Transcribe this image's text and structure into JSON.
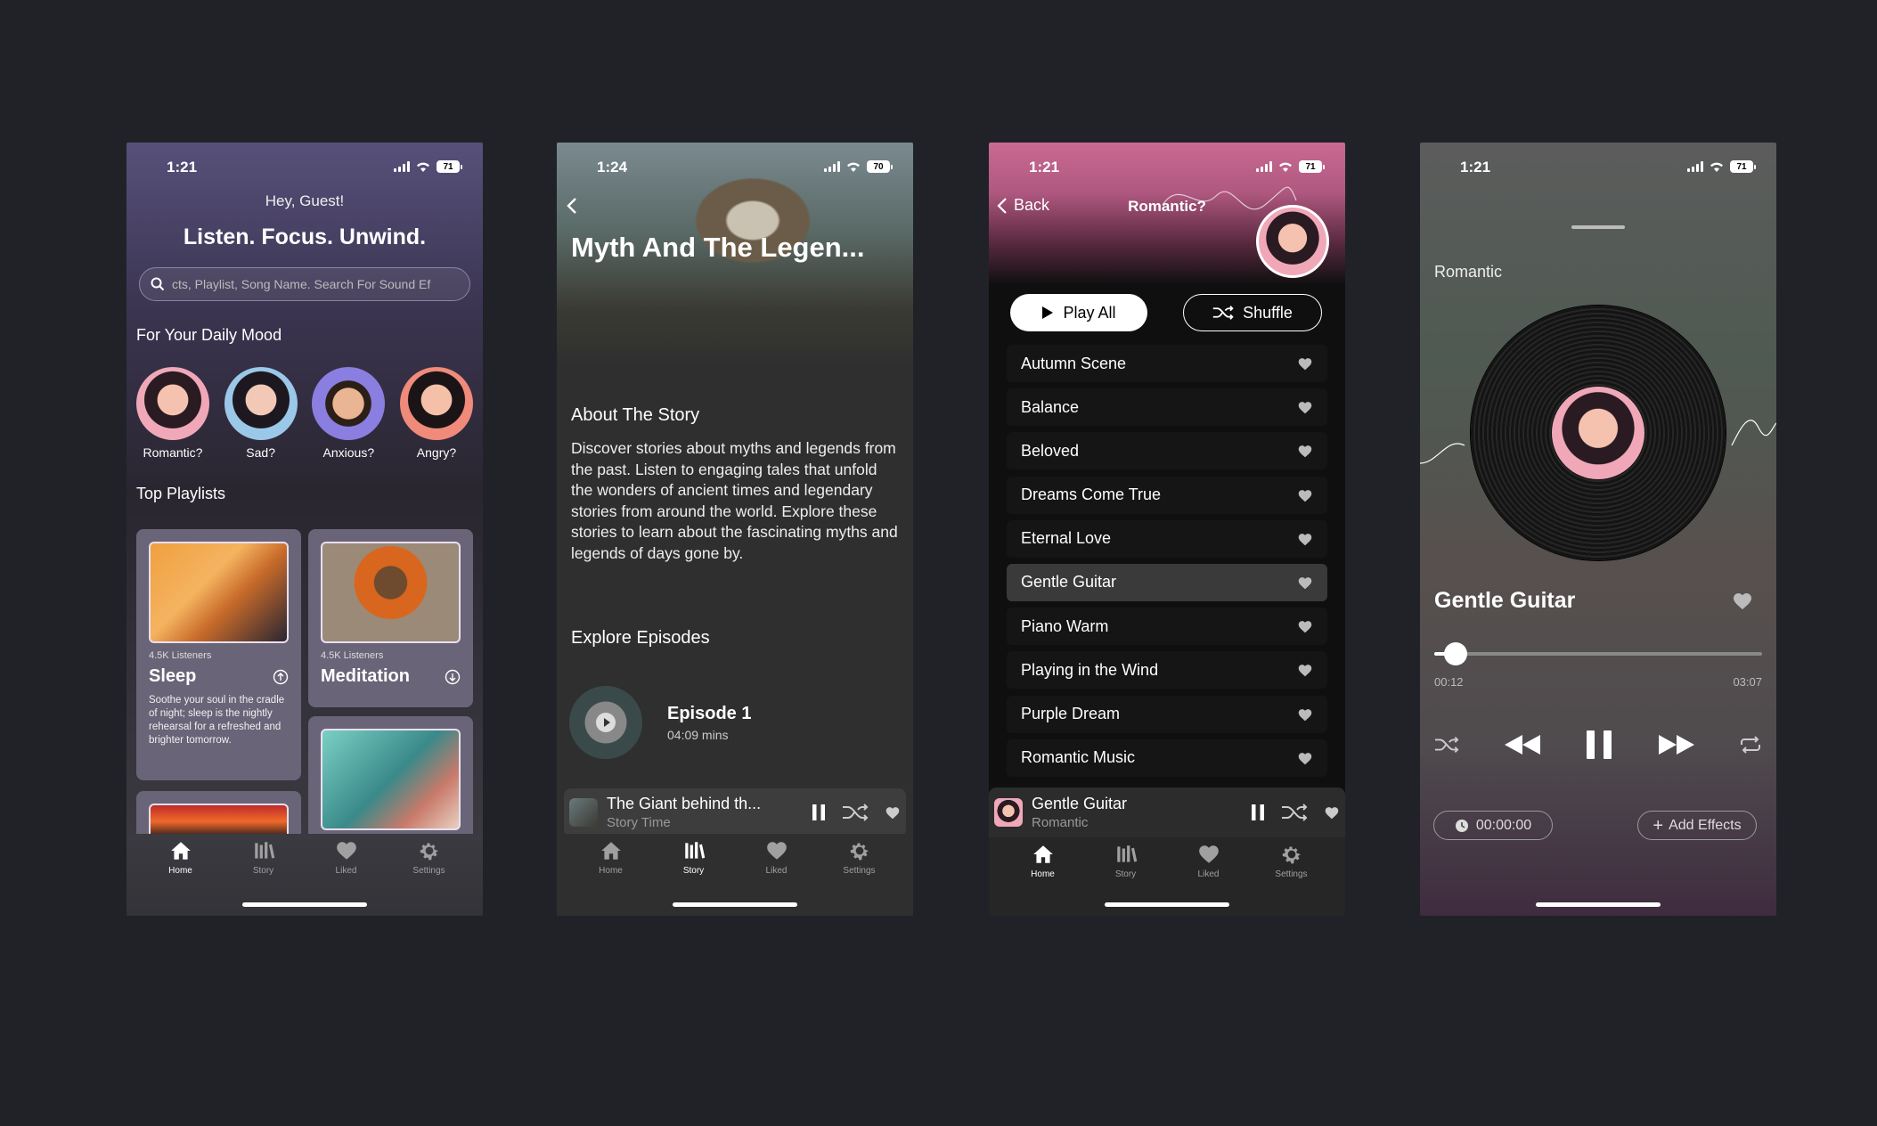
{
  "status_time_1": "1:21",
  "status_time_2": "1:24",
  "status_time_3": "1:21",
  "status_time_4": "1:21",
  "battery_1": "71",
  "battery_2": "70",
  "battery_3": "71",
  "battery_4": "71",
  "home": {
    "greeting": "Hey, Guest!",
    "headline": "Listen. Focus. Unwind.",
    "search_value": "cts, Playlist, Song Name. Search For Sound Ef",
    "mood_title": "For Your Daily Mood",
    "moods": [
      {
        "label": "Romantic?",
        "color": "#f0a8b8"
      },
      {
        "label": "Sad?",
        "color": "#9bc8e8"
      },
      {
        "label": "Anxious?",
        "color": "#8a7ee0"
      },
      {
        "label": "Angry?",
        "color": "#f08a7a"
      }
    ],
    "playlists_title": "Top Playlists",
    "playlists": [
      {
        "listeners": "4.5K Listeners",
        "title": "Sleep",
        "desc": "Soothe your soul in the cradle of night; sleep is the nightly rehearsal for a refreshed and brighter tomorrow."
      },
      {
        "listeners": "4.5K Listeners",
        "title": "Meditation"
      }
    ]
  },
  "tabs": [
    {
      "label": "Home",
      "icon": "home-icon"
    },
    {
      "label": "Story",
      "icon": "library-icon"
    },
    {
      "label": "Liked",
      "icon": "heart-icon"
    },
    {
      "label": "Settings",
      "icon": "gear-icon"
    }
  ],
  "story": {
    "title": "Myth And The Legen...",
    "about_title": "About The Story",
    "about_text": "Discover stories about myths and legends from the past. Listen to engaging tales that unfold the wonders of ancient times and legendary stories from around the world. Explore these stories to learn about the fascinating myths and legends of days gone by.",
    "explore_title": "Explore Episodes",
    "episode_title": "Episode 1",
    "episode_duration": "04:09 mins",
    "mini_title": "The Giant behind th...",
    "mini_subtitle": "Story Time"
  },
  "playlist": {
    "back_label": "Back",
    "title": "Romantic?",
    "play_all": "Play All",
    "shuffle": "Shuffle",
    "songs": [
      "Autumn Scene",
      "Balance",
      "Beloved",
      "Dreams Come True",
      "Eternal Love",
      "Gentle Guitar",
      "Piano Warm",
      "Playing in the Wind",
      "Purple Dream",
      "Romantic Music"
    ],
    "selected": "Gentle Guitar",
    "mini_title": "Gentle Guitar",
    "mini_subtitle": "Romantic"
  },
  "player": {
    "category": "Romantic",
    "track": "Gentle Guitar",
    "elapsed": "00:12",
    "total": "03:07",
    "progress": 0.065,
    "timer": "00:00:00",
    "add_effects": "Add Effects"
  },
  "colors": {
    "pink_header": "#c96a93",
    "accent_white": "#ffffff"
  }
}
